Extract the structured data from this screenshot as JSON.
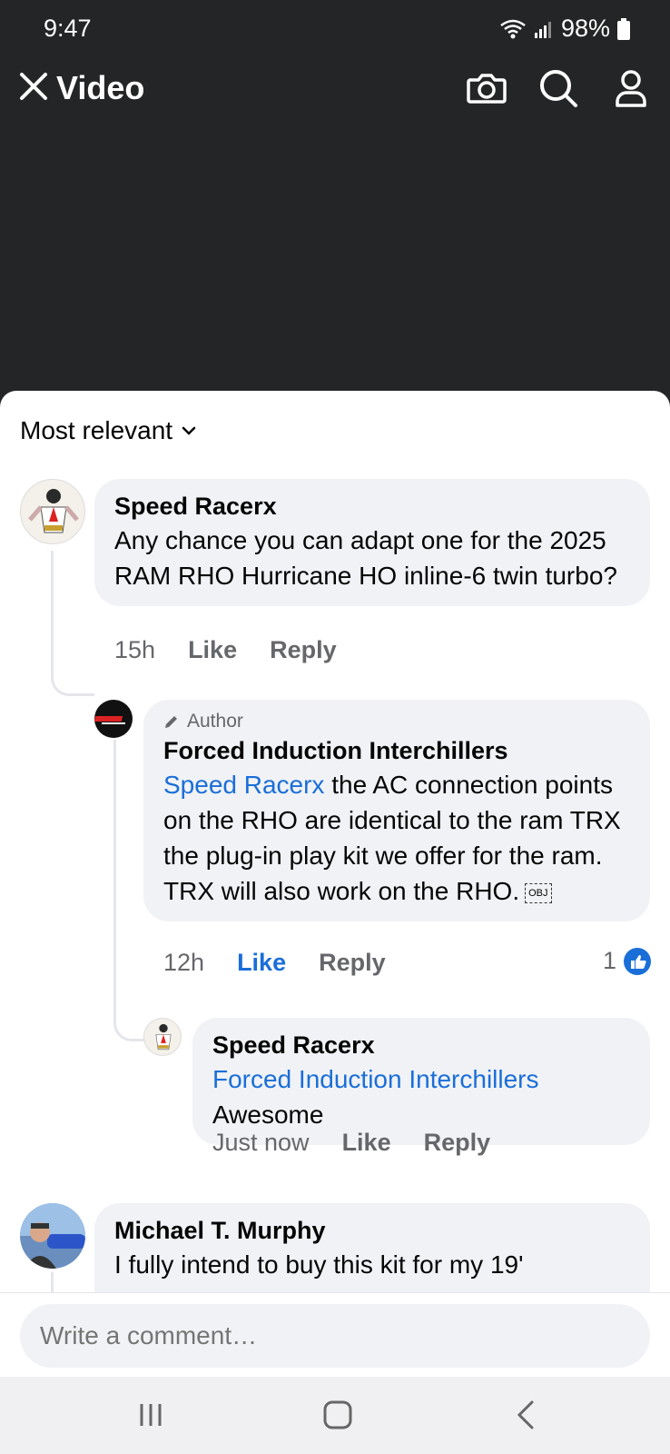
{
  "status": {
    "time": "9:47",
    "battery": "98%"
  },
  "header": {
    "title": "Video"
  },
  "sort": {
    "label": "Most relevant"
  },
  "comments": [
    {
      "name": "Speed Racerx",
      "text": "Any chance you can adapt one for the 2025 RAM RHO Hurricane HO inline-6 twin turbo?",
      "time": "15h",
      "like": "Like",
      "reply": "Reply"
    },
    {
      "author_tag": "Author",
      "name": "Forced Induction Interchillers",
      "mention": "Speed Racerx",
      "text": " the AC connection points on the RHO are identical to the ram TRX the plug-in play kit we offer for the ram. TRX will also work on the RHO.",
      "obj": "OBJ",
      "time": "12h",
      "like": "Like",
      "reply": "Reply",
      "reactions": "1"
    },
    {
      "name": "Speed Racerx",
      "mention": "Forced Induction Interchillers",
      "text": "Awesome",
      "time": "Just now",
      "like": "Like",
      "reply": "Reply"
    },
    {
      "name": "Michael T. Murphy",
      "text": "I fully intend to buy this kit for my 19'"
    }
  ],
  "composer": {
    "placeholder": "Write a comment…"
  },
  "colors": {
    "accent": "#1a6ed8",
    "bubble": "#f0f2f5",
    "dark_bg": "#242526"
  }
}
